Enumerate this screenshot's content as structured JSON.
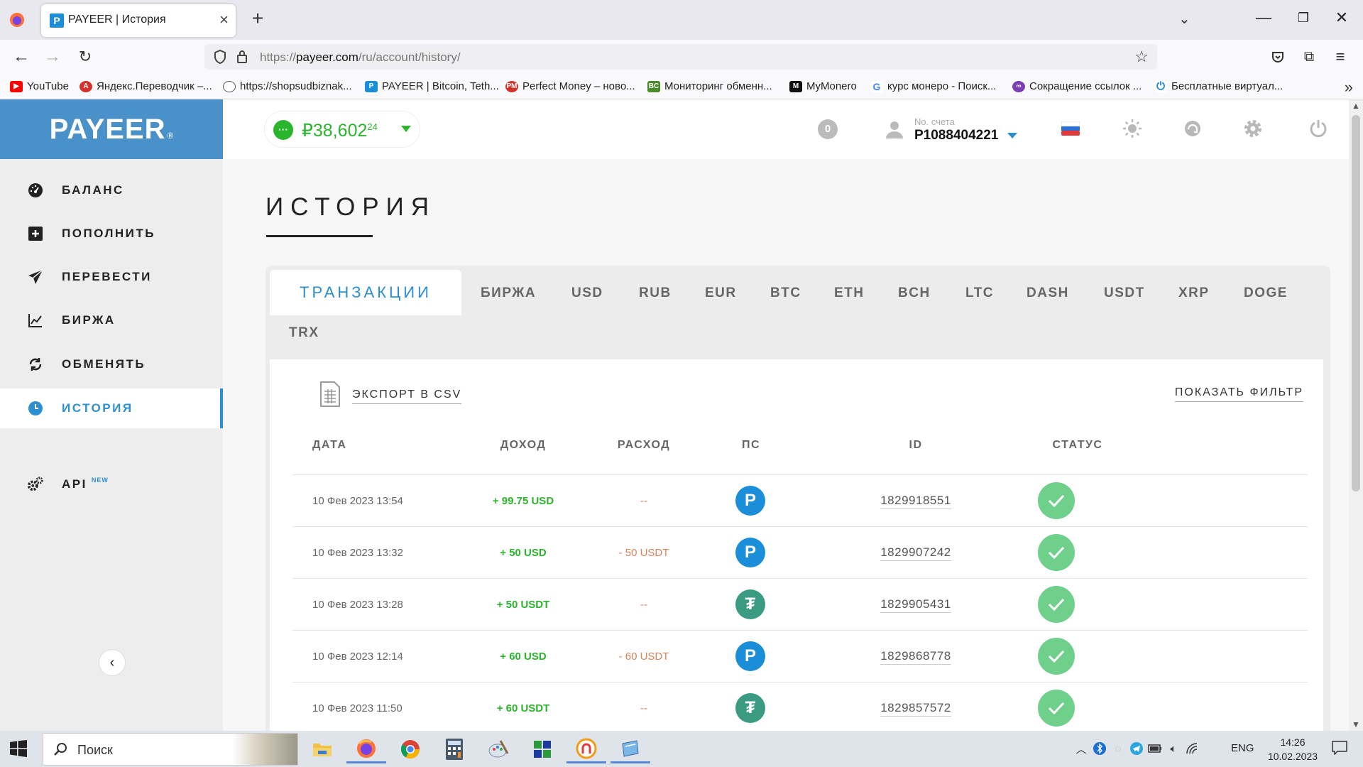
{
  "browser": {
    "tab_title": "PAYEER | История",
    "url_prefix": "https://",
    "url_domain": "payeer.com",
    "url_path": "/ru/account/history/",
    "bookmarks": [
      "YouTube",
      "Яндекс.Переводчик –...",
      "https://shopsudbiznak...",
      "PAYEER | Bitcoin, Teth...",
      "Perfect Money – ново...",
      "Мониторинг обменн...",
      "MyMonero",
      "курс монеро - Поиск...",
      "Сокращение ссылок ...",
      "Бесплатные виртуал..."
    ]
  },
  "sidebar": {
    "logo": "PAYEER",
    "logo_mark": "®",
    "items": [
      {
        "label": "БАЛАНС"
      },
      {
        "label": "ПОПОЛНИТЬ"
      },
      {
        "label": "ПЕРЕВЕСТИ"
      },
      {
        "label": "БИРЖА"
      },
      {
        "label": "ОБМЕНЯТЬ"
      },
      {
        "label": "ИСТОРИЯ"
      },
      {
        "label": "API",
        "badge": "NEW"
      }
    ]
  },
  "header": {
    "balance_main": "₽38,602",
    "balance_cents": "24",
    "notifications": "0",
    "account_label": "No. счета",
    "account_number": "P1088404221"
  },
  "main": {
    "title": "ИСТОРИЯ",
    "tabs": [
      "ТРАНЗАКЦИИ",
      "БИРЖА",
      "USD",
      "RUB",
      "EUR",
      "BTC",
      "ETH",
      "BCH",
      "LTC",
      "DASH",
      "USDT",
      "XRP",
      "DOGE",
      "TRX"
    ],
    "export_label": "ЭКСПОРТ В CSV",
    "filter_label": "ПОКАЗАТЬ ФИЛЬТР",
    "columns": [
      "ДАТА",
      "ДОХОД",
      "РАСХОД",
      "ПС",
      "ID",
      "СТАТУС"
    ],
    "rows": [
      {
        "date": "10 Фев 2023 13:54",
        "income": "+ 99.75 USD",
        "expense": "--",
        "ps": "P",
        "id": "1829918551"
      },
      {
        "date": "10 Фев 2023 13:32",
        "income": "+ 50 USD",
        "expense": "- 50 USDT",
        "ps": "P",
        "id": "1829907242"
      },
      {
        "date": "10 Фев 2023 13:28",
        "income": "+ 50 USDT",
        "expense": "--",
        "ps": "T",
        "id": "1829905431"
      },
      {
        "date": "10 Фев 2023 12:14",
        "income": "+ 60 USD",
        "expense": "- 60 USDT",
        "ps": "P",
        "id": "1829868778"
      },
      {
        "date": "10 Фев 2023 11:50",
        "income": "+ 60 USDT",
        "expense": "--",
        "ps": "T",
        "id": "1829857572"
      }
    ]
  },
  "taskbar": {
    "search_placeholder": "Поиск",
    "lang": "ENG",
    "time": "14:26",
    "date": "10.02.2023"
  },
  "colors": {
    "brand_blue": "#4a90c9",
    "accent": "#2c8fd1",
    "income_green": "#2ab52c",
    "expense_orange": "#d9835a",
    "status_green": "#6fd08c"
  }
}
